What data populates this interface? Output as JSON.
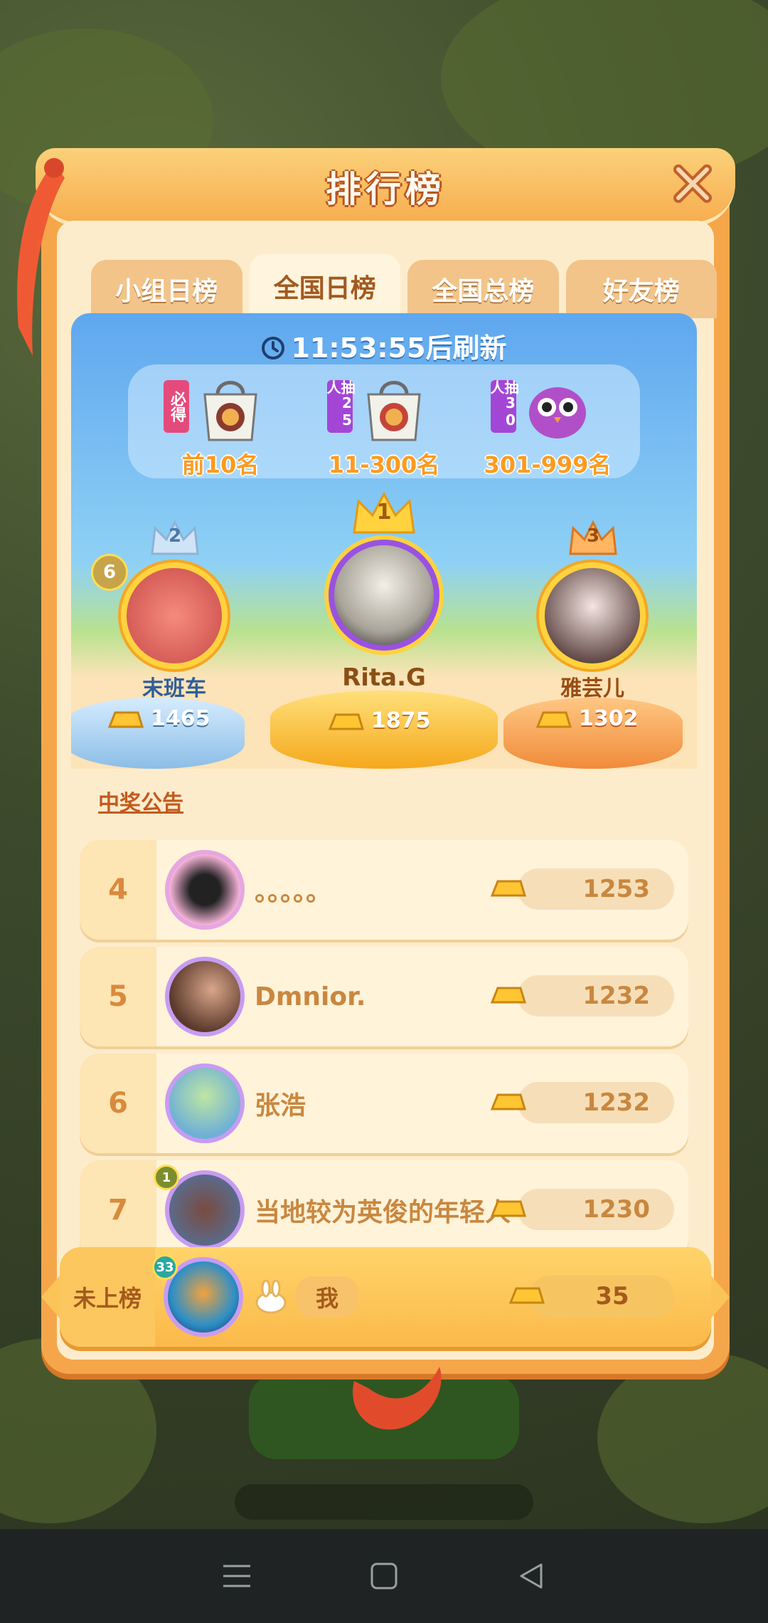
{
  "window": {
    "title": "排行榜"
  },
  "tabs": [
    {
      "label": "小组日榜",
      "active": false
    },
    {
      "label": "全国日榜",
      "active": true
    },
    {
      "label": "全国总榜",
      "active": false
    },
    {
      "label": "好友榜",
      "active": false
    }
  ],
  "timer": {
    "time": "11:53:55",
    "suffix": "后刷新"
  },
  "rewards": [
    {
      "tag": "必得",
      "label": "前10名",
      "icon": "gift-bag-icon"
    },
    {
      "tag": "抽25人",
      "label": "11-300名",
      "icon": "gift-bag-icon"
    },
    {
      "tag": "抽30人",
      "label": "301-999名",
      "icon": "owl-plush-icon"
    }
  ],
  "podium": {
    "first": {
      "rank": "1",
      "name": "Rita.G",
      "score": "1875"
    },
    "second": {
      "rank": "2",
      "name": "末班车",
      "score": "1465",
      "level": "6"
    },
    "third": {
      "rank": "3",
      "name": "雅芸儿",
      "score": "1302"
    }
  },
  "announcement_link": "中奖公告",
  "leaderboard": [
    {
      "rank": "4",
      "name": "。。。。。",
      "score": "1253"
    },
    {
      "rank": "5",
      "name": "Dmnior.",
      "score": "1232"
    },
    {
      "rank": "6",
      "name": "张浩",
      "score": "1232"
    },
    {
      "rank": "7",
      "name": "当地较为英俊的年轻人",
      "score": "1230",
      "level": "1"
    }
  ],
  "me": {
    "rank_label": "未上榜",
    "tag": "我",
    "score": "35",
    "level": "33"
  },
  "colors": {
    "accent": "#f6a64a",
    "panel": "#fdeccc",
    "gold": "#ffc532",
    "rank_text": "#d98a3c"
  },
  "navbar": {
    "icons": [
      "menu-icon",
      "home-square-icon",
      "back-triangle-icon"
    ]
  }
}
